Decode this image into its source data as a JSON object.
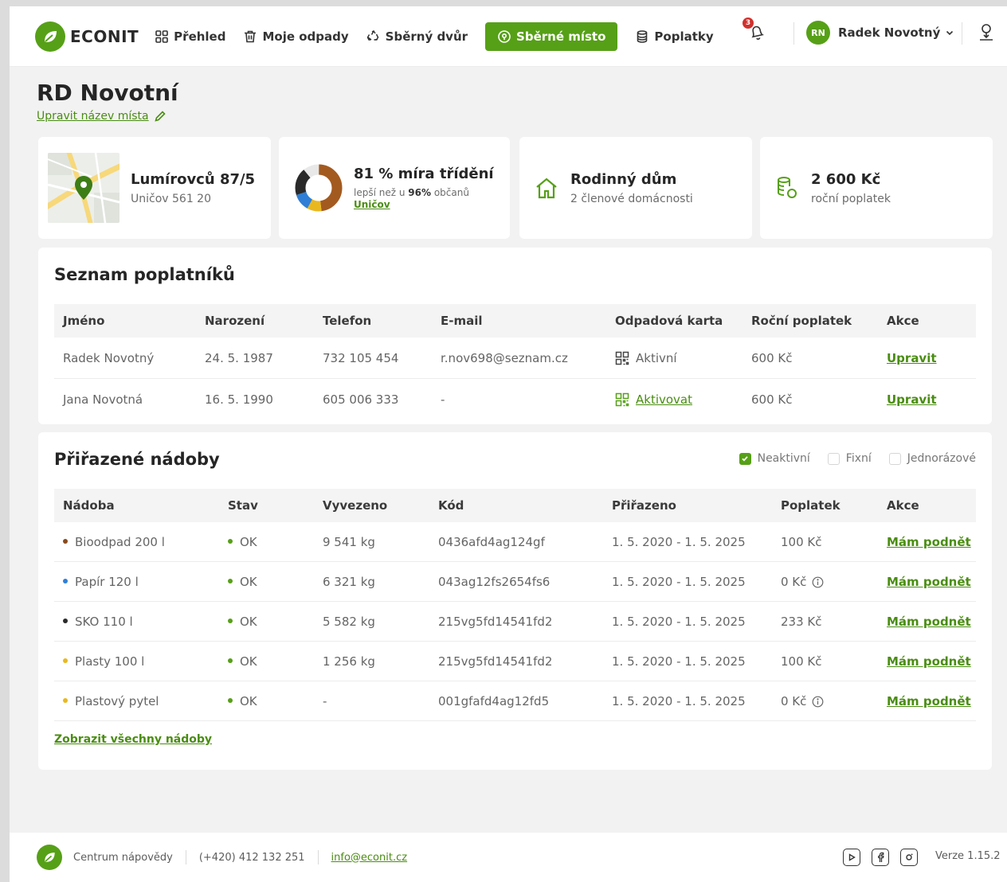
{
  "brand": {
    "name": "ECONIT",
    "color": "#56a017"
  },
  "nav": {
    "items": [
      {
        "label": "Přehled",
        "icon": "grid-icon"
      },
      {
        "label": "Moje odpady",
        "icon": "trash-icon"
      },
      {
        "label": "Sběrný dvůr",
        "icon": "recycle-icon"
      },
      {
        "label": "Sběrné místo",
        "icon": "location-pin-icon",
        "active": true
      },
      {
        "label": "Poplatky",
        "icon": "coins-icon"
      }
    ]
  },
  "notifications": {
    "count": "3"
  },
  "user": {
    "initials": "RN",
    "name": "Radek Novotný"
  },
  "page": {
    "title": "RD Novotní",
    "rename_link": "Upravit název místa"
  },
  "cards": {
    "address": {
      "title": "Lumírovců 87/5",
      "sub": "Uničov 561 20"
    },
    "sorting": {
      "title": "81 % míra třídění",
      "sub_prefix": "lepší než u",
      "sub_bold": "96%",
      "sub_suffix": "občanů",
      "link": "Uničov",
      "segments": [
        {
          "color": "#a35a1f",
          "value": 48
        },
        {
          "color": "#e9b820",
          "value": 10
        },
        {
          "color": "#2f7fd6",
          "value": 12
        },
        {
          "color": "#2a2a2a",
          "value": 19
        },
        {
          "color": "#e8e8e8",
          "value": 11
        }
      ]
    },
    "house": {
      "title": "Rodinný dům",
      "sub": "2 členové domácnosti"
    },
    "fee": {
      "title": "2 600 Kč",
      "sub": "roční poplatek"
    }
  },
  "payers": {
    "title": "Seznam poplatníků",
    "columns": [
      "Jméno",
      "Narození",
      "Telefon",
      "E-mail",
      "Odpadová karta",
      "Roční poplatek",
      "Akce"
    ],
    "rows": [
      {
        "name": "Radek Novotný",
        "birth": "24. 5. 1987",
        "phone": "732 105 454",
        "email": "r.nov698@seznam.cz",
        "card": "Aktivní",
        "card_link": false,
        "fee": "600 Kč",
        "action": "Upravit"
      },
      {
        "name": "Jana Novotná",
        "birth": "16. 5. 1990",
        "phone": "605 006 333",
        "email": "-",
        "card": "Aktivovat",
        "card_link": true,
        "fee": "600 Kč",
        "action": "Upravit"
      }
    ]
  },
  "containers": {
    "title": "Přiřazené nádoby",
    "filters": [
      {
        "label": "Neaktivní",
        "checked": true
      },
      {
        "label": "Fixní",
        "checked": false
      },
      {
        "label": "Jednorázové",
        "checked": false
      }
    ],
    "columns": [
      "Nádoba",
      "Stav",
      "Vyvezeno",
      "Kód",
      "Přiřazeno",
      "Poplatek",
      "Akce"
    ],
    "rows": [
      {
        "name": "Bioodpad 200 l",
        "dot": "#8a4a1c",
        "status": "OK",
        "weight": "9 541 kg",
        "code": "0436afd4ag124gf",
        "period": "1. 5. 2020 - 1. 5. 2025",
        "fee": "100 Kč",
        "info": false,
        "action": "Mám podnět"
      },
      {
        "name": "Papír 120 l",
        "dot": "#2f7fd6",
        "status": "OK",
        "weight": "6 321 kg",
        "code": "043ag12fs2654fs6",
        "period": "1. 5. 2020 - 1. 5. 2025",
        "fee": "0 Kč",
        "info": true,
        "action": "Mám podnět"
      },
      {
        "name": "SKO 110 l",
        "dot": "#2a2a2a",
        "status": "OK",
        "weight": "5 582 kg",
        "code": "215vg5fd14541fd2",
        "period": "1. 5. 2020 - 1. 5. 2025",
        "fee": "233 Kč",
        "info": false,
        "action": "Mám podnět"
      },
      {
        "name": "Plasty 100 l",
        "dot": "#e9b820",
        "status": "OK",
        "weight": "1 256 kg",
        "code": "215vg5fd14541fd2",
        "period": "1. 5. 2020 - 1. 5. 2025",
        "fee": "100 Kč",
        "info": false,
        "action": "Mám podnět"
      },
      {
        "name": "Plastový pytel",
        "dot": "#e9b820",
        "status": "OK",
        "weight": "-",
        "code": "001gfafd4ag12fd5",
        "period": "1. 5. 2020 - 1. 5. 2025",
        "fee": "0 Kč",
        "info": true,
        "action": "Mám podnět"
      }
    ],
    "status_color": "#56a017",
    "show_all": "Zobrazit všechny nádoby"
  },
  "footer": {
    "help": "Centrum nápovědy",
    "phone": "(+420) 412 132 251",
    "email": "info@econit.cz",
    "social": [
      "youtube-icon",
      "facebook-icon",
      "instagram-icon"
    ],
    "version": "Verze 1.15.2"
  }
}
